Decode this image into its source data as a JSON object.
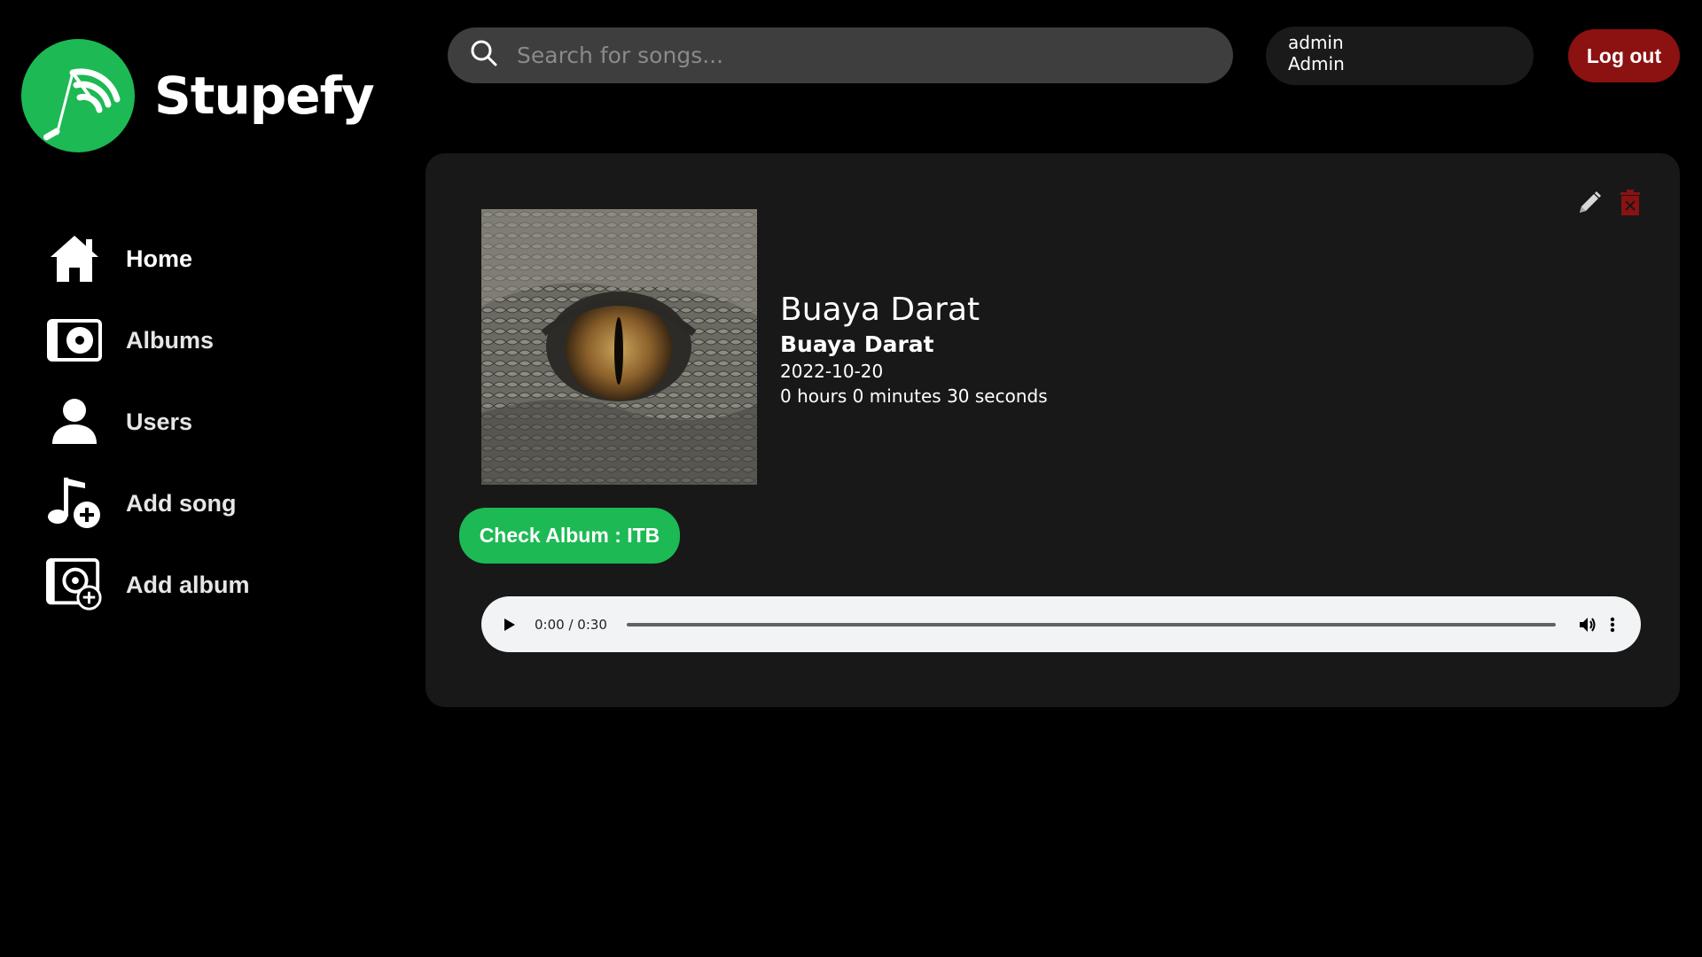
{
  "app": {
    "name": "Stupefy"
  },
  "sidebar": {
    "items": [
      {
        "label": "Home",
        "icon": "home-icon"
      },
      {
        "label": "Albums",
        "icon": "album-icon"
      },
      {
        "label": "Users",
        "icon": "user-icon"
      },
      {
        "label": "Add song",
        "icon": "add-song-icon"
      },
      {
        "label": "Add album",
        "icon": "add-album-icon"
      }
    ]
  },
  "search": {
    "placeholder": "Search for songs..."
  },
  "user": {
    "username": "admin",
    "role": "Admin"
  },
  "header": {
    "logout_label": "Log out"
  },
  "song": {
    "title": "Buaya Darat",
    "artist": "Buaya Darat",
    "date": "2022-10-20",
    "duration": "0 hours 0 minutes 30 seconds",
    "album_button": "Check Album : ITB"
  },
  "player": {
    "time": "0:00 / 0:30",
    "progress": 0
  },
  "colors": {
    "accent": "#1db954",
    "danger": "#8c1111",
    "card_bg": "#181818",
    "search_bg": "#3e3e3e"
  }
}
